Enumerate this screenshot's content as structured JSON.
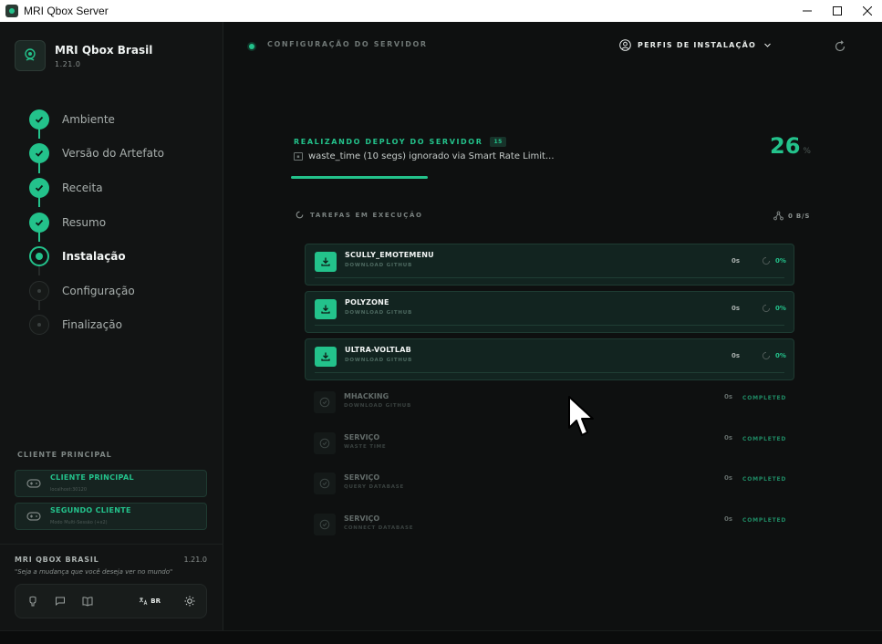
{
  "window": {
    "title": "MRI Qbox Server"
  },
  "sidebar": {
    "brand_name": "MRI Qbox Brasil",
    "brand_version": "1.21.0",
    "steps": [
      {
        "label": "Ambiente",
        "state": "done"
      },
      {
        "label": "Versão do Artefato",
        "state": "done"
      },
      {
        "label": "Receita",
        "state": "done"
      },
      {
        "label": "Resumo",
        "state": "done"
      },
      {
        "label": "Instalação",
        "state": "active"
      },
      {
        "label": "Configuração",
        "state": "pending"
      },
      {
        "label": "Finalização",
        "state": "pending"
      }
    ],
    "client_section_title": "CLIENTE PRINCIPAL",
    "clients": [
      {
        "title": "CLIENTE PRINCIPAL",
        "subtitle": "localhost:30120"
      },
      {
        "title": "SEGUNDO CLIENTE",
        "subtitle": "Modo Multi-Sessão (+x2)"
      }
    ],
    "footer": {
      "brand": "MRI QBOX BRASIL",
      "version": "1.21.0",
      "quote": "\"Seja a mudança que você deseja ver no mundo\"",
      "language": "BR"
    }
  },
  "header": {
    "title": "CONFIGURAÇÃO DO SERVIDOR",
    "profiles_label": "PERFIS DE INSTALAÇÃO"
  },
  "deploy": {
    "title": "REALIZANDO DEPLOY DO SERVIDOR",
    "badge": "15",
    "message": "waste_time (10 segs) ignorado via Smart Rate Limit...",
    "percent": "26",
    "percent_sign": "%",
    "progress": 0.26
  },
  "tasks": {
    "title": "TAREFAS EM EXECUÇÃO",
    "rate": "0 B/S",
    "running": [
      {
        "name": "SCULLY_EMOTEMENU",
        "sub": "DOWNLOAD GITHUB",
        "time": "0s",
        "pct": "0%"
      },
      {
        "name": "POLYZONE",
        "sub": "DOWNLOAD GITHUB",
        "time": "0s",
        "pct": "0%"
      },
      {
        "name": "ULTRA-VOLTLAB",
        "sub": "DOWNLOAD GITHUB",
        "time": "0s",
        "pct": "0%"
      }
    ],
    "completed": [
      {
        "name": "MHACKING",
        "sub": "DOWNLOAD GITHUB",
        "time": "0s",
        "status": "COMPLETED"
      },
      {
        "name": "SERVIÇO",
        "sub": "WASTE TIME",
        "time": "0s",
        "status": "COMPLETED"
      },
      {
        "name": "SERVIÇO",
        "sub": "QUERY DATABASE",
        "time": "0s",
        "status": "COMPLETED"
      },
      {
        "name": "SERVIÇO",
        "sub": "CONNECT DATABASE",
        "time": "0s",
        "status": "COMPLETED"
      }
    ]
  },
  "colors": {
    "accent": "#23c28b",
    "background": "#0e1010",
    "sidebar": "#121414"
  }
}
